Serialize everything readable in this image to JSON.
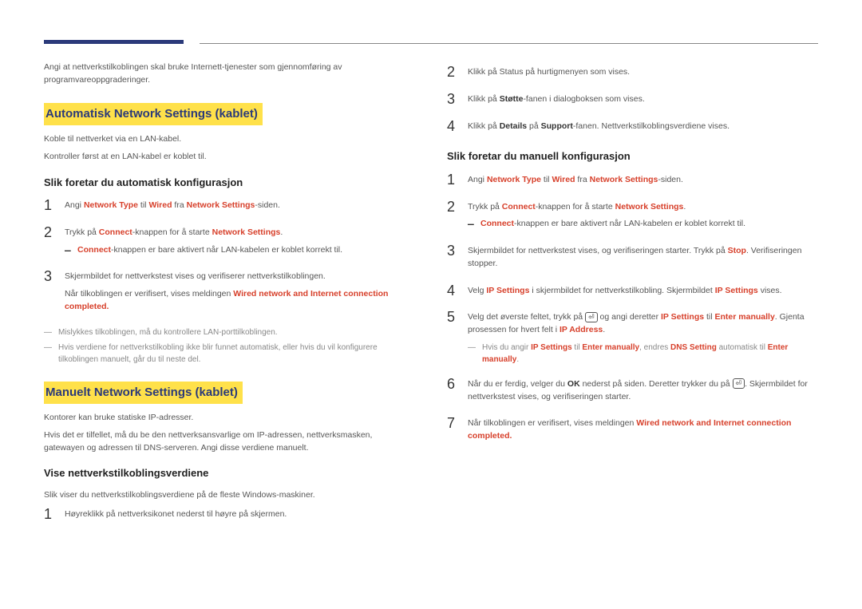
{
  "left": {
    "intro": "Angi at nettverkstilkoblingen skal bruke Internett-tjenester som gjennomføring av programvareoppgraderinger.",
    "h1": "Automatisk Network Settings  (kablet)",
    "p1": "Koble til nettverket via en LAN-kabel.",
    "p2": "Kontroller først at en LAN-kabel er koblet til.",
    "h2": "Slik foretar du automatisk konfigurasjon",
    "s1": {
      "pre": "Angi ",
      "a": "Network Type",
      "mid": " til ",
      "b": "Wired",
      "mid2": " fra ",
      "c": "Network Settings",
      "post": "-siden."
    },
    "s2": {
      "pre": "Trykk på ",
      "a": "Connect",
      "mid": "-knappen for å starte ",
      "b": "Network Settings",
      "post": "."
    },
    "s2d": {
      "a": "Connect",
      "post": "-knappen er bare aktivert når LAN-kabelen er koblet korrekt til."
    },
    "s3a": "Skjermbildet for nettverkstest vises og verifiserer nettverkstilkoblingen.",
    "s3b": {
      "pre": "Når tilkoblingen er verifisert, vises meldingen ",
      "msg": "Wired network and Internet connection completed."
    },
    "n1": "Mislykkes tilkoblingen, må du kontrollere LAN-porttilkoblingen.",
    "n2": "Hvis verdiene for nettverkstilkobling ikke blir funnet automatisk, eller hvis du vil konfigurere tilkoblingen manuelt, går du til neste del.",
    "h3": "Manuelt Network Settings (kablet)",
    "p3": "Kontorer kan bruke statiske IP-adresser.",
    "p4": "Hvis det er tilfellet, må du be den nettverksansvarlige om IP-adressen, nettverksmasken, gatewayen og adressen til DNS-serveren. Angi disse verdiene manuelt.",
    "h4": "Vise nettverkstilkoblingsverdiene",
    "p5": "Slik viser du nettverkstilkoblingsverdiene på de fleste Windows-maskiner.",
    "s4": "Høyreklikk på nettverksikonet nederst til høyre på skjermen."
  },
  "right": {
    "r2": "Klikk på Status på hurtigmenyen som vises.",
    "r3": {
      "pre": "Klikk på ",
      "a": "Støtte",
      "post": "-fanen i dialogboksen som vises."
    },
    "r4": {
      "pre": "Klikk på ",
      "a": "Details",
      "mid": " på ",
      "b": "Support",
      "post": "-fanen. Nettverkstilkoblingsverdiene vises."
    },
    "h5": "Slik foretar du manuell konfigurasjon",
    "m1": {
      "pre": "Angi ",
      "a": "Network Type",
      "mid": " til ",
      "b": "Wired",
      "mid2": " fra ",
      "c": "Network Settings",
      "post": "-siden."
    },
    "m2": {
      "pre": "Trykk på ",
      "a": "Connect",
      "mid": "-knappen for å starte ",
      "b": "Network Settings",
      "post": "."
    },
    "m2d": {
      "a": "Connect",
      "post": "-knappen er bare aktivert når LAN-kabelen er koblet korrekt til."
    },
    "m3": {
      "pre": "Skjermbildet for nettverkstest vises, og verifiseringen starter. Trykk på ",
      "a": "Stop",
      "post": ". Verifiseringen stopper."
    },
    "m4": {
      "pre": "Velg ",
      "a": "IP Settings",
      "mid": " i skjermbildet for nettverkstilkobling. Skjermbildet ",
      "b": "IP Settings",
      "post": " vises."
    },
    "m5": {
      "pre": "Velg det øverste feltet, trykk på ",
      "mid1": " og angi deretter ",
      "a": "IP Settings",
      "mid2": " til ",
      "b": "Enter manually",
      "mid3": ". Gjenta prosessen for hvert felt i ",
      "c": "IP Address",
      "post": "."
    },
    "m5note": {
      "pre": "Hvis du angir ",
      "a": "IP Settings",
      "mid1": " til ",
      "b": "Enter manually",
      "mid2": ", endres ",
      "c": "DNS Setting",
      "mid3": " automatisk til ",
      "d": "Enter manually",
      "post": "."
    },
    "m6": {
      "pre": "Når du er ferdig, velger du ",
      "a": "OK",
      "mid": " nederst på siden. Deretter trykker du på ",
      "post": ". Skjermbildet for nettverkstest vises, og verifiseringen starter."
    },
    "m7": {
      "pre": "Når tilkoblingen er verifisert, vises meldingen ",
      "msg": "Wired network and Internet connection completed."
    }
  },
  "icons": {
    "enter": "⏎"
  }
}
